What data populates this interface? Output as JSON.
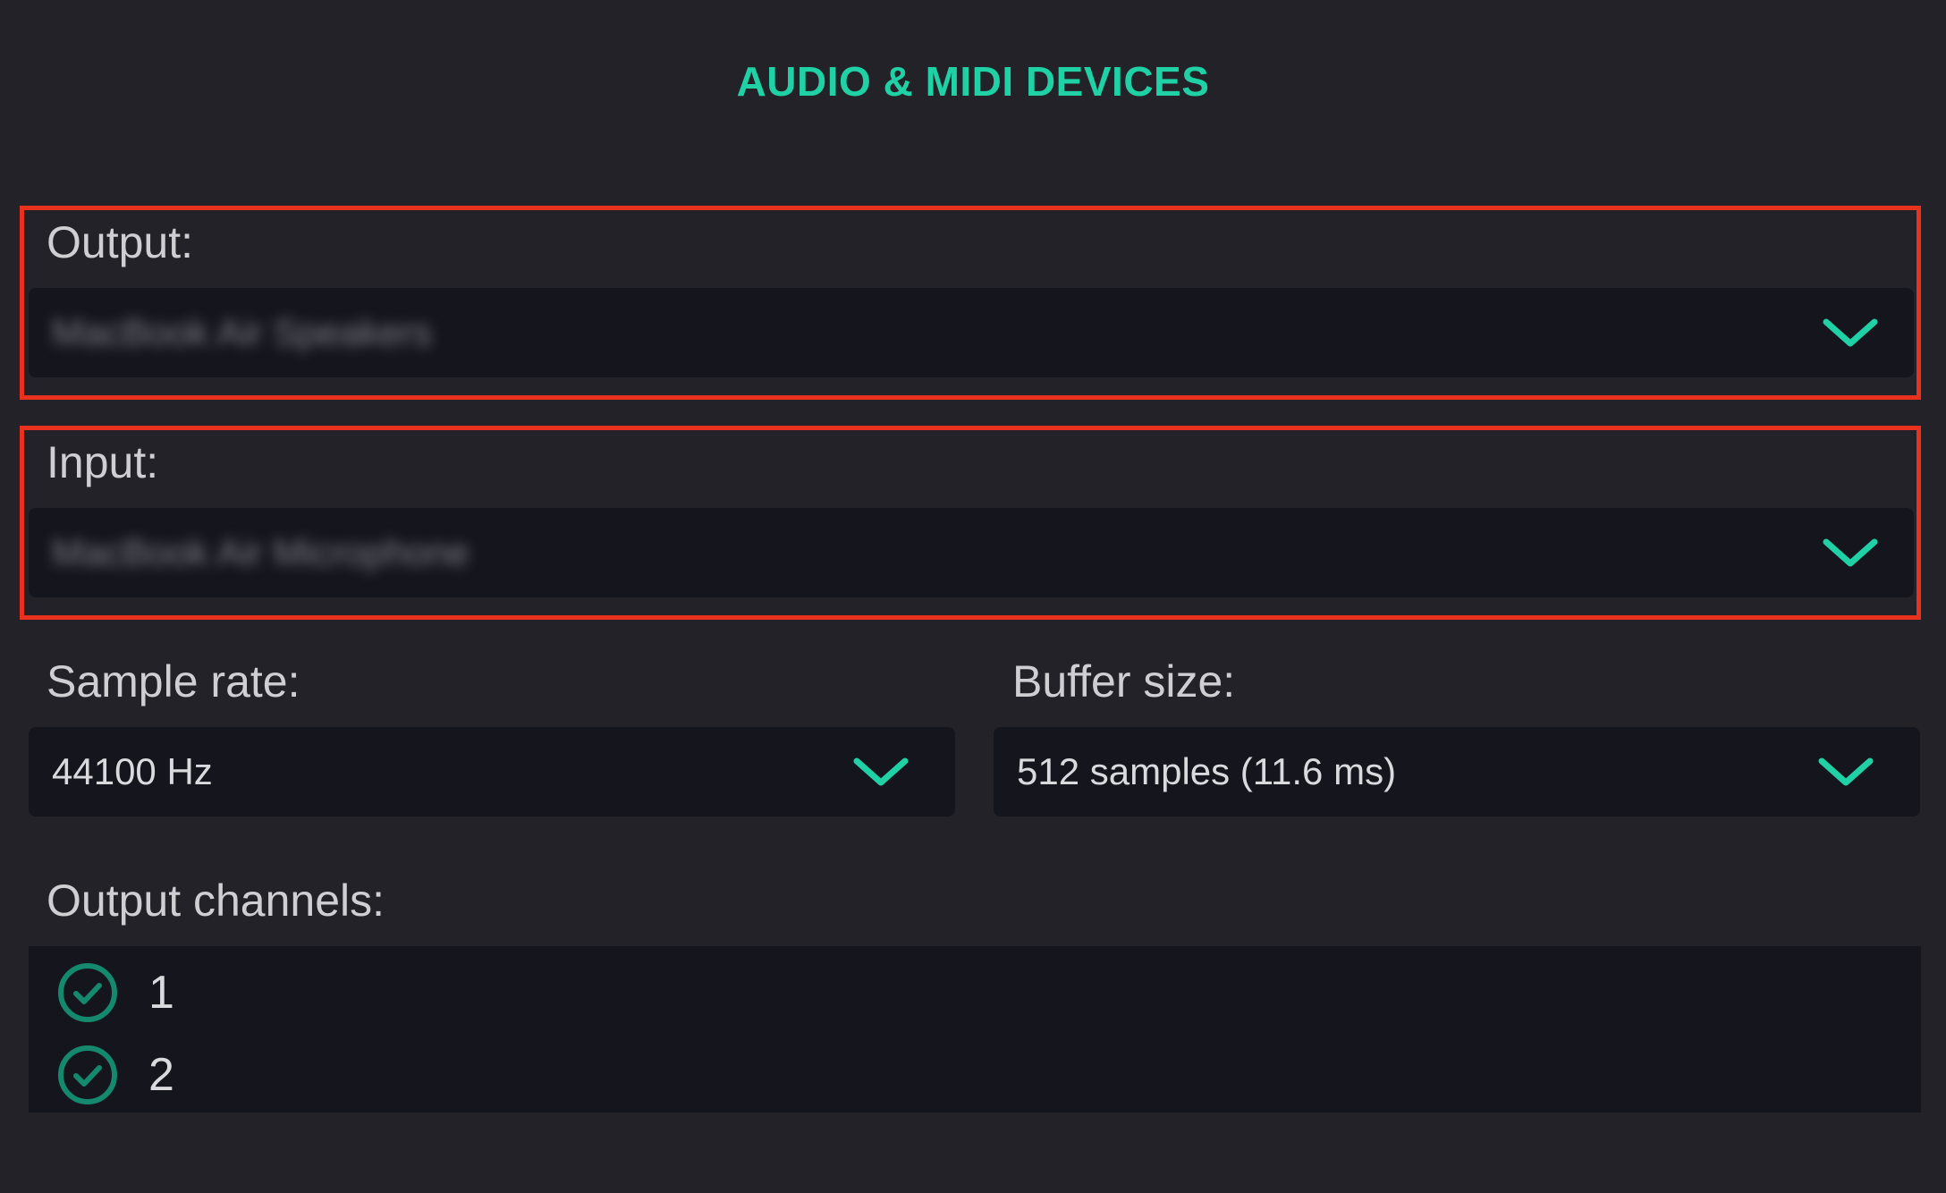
{
  "header": {
    "title": "AUDIO & MIDI DEVICES"
  },
  "output": {
    "label": "Output:",
    "value": "MacBook Air Speakers"
  },
  "input": {
    "label": "Input:",
    "value": "MacBook Air Microphone"
  },
  "sample_rate": {
    "label": "Sample rate:",
    "value": "44100 Hz"
  },
  "buffer_size": {
    "label": "Buffer size:",
    "value": "512 samples (11.6 ms)"
  },
  "output_channels": {
    "label": "Output channels:",
    "items": [
      {
        "label": "1",
        "checked": true
      },
      {
        "label": "2",
        "checked": true
      }
    ]
  },
  "icons": {
    "dropdown": "chevron-down-icon",
    "channel_state": "check-circle-icon"
  },
  "colors": {
    "accent": "#1fd1a5",
    "highlight": "#e8321d",
    "background": "#222228",
    "field": "#15161d"
  }
}
